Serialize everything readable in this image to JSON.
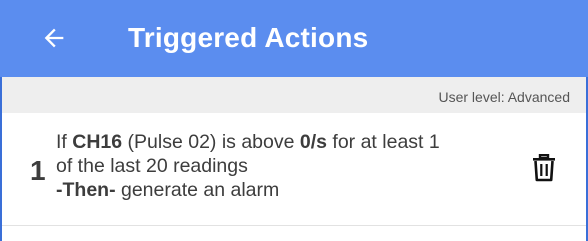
{
  "header": {
    "title": "Triggered Actions",
    "back_icon": "arrow-left-icon"
  },
  "user_level": "User level: Advanced",
  "actions": [
    {
      "number": "1",
      "if_label": "If ",
      "channel": "CH16",
      "channel_desc": " (Pulse 02) is above ",
      "threshold": "0/s",
      "condition_rest": " for at least 1",
      "condition_line2": "of the last 20 readings",
      "then_label": "-Then-",
      "then_action": " generate an alarm",
      "delete_icon": "trash-icon"
    }
  ],
  "colors": {
    "appbar": "#5b8def",
    "frame": "#3a6fd8",
    "level_bar": "#eeeeee",
    "text": "#3d3d3d"
  }
}
